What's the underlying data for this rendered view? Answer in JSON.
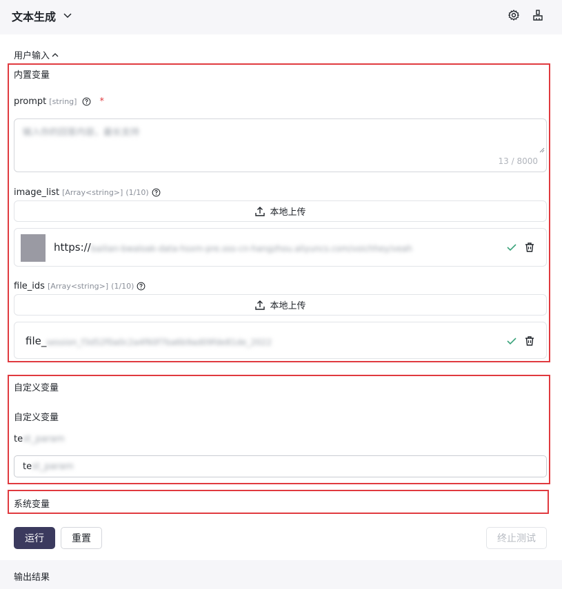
{
  "header": {
    "title": "文本生成",
    "settings_icon": "gear-icon",
    "clear_icon": "broom-icon"
  },
  "user_input": {
    "toggle_label": "用户输入"
  },
  "builtin": {
    "section_label": "内置变量",
    "prompt": {
      "name": "prompt",
      "type": "[string]",
      "required_mark": "*",
      "value": "输入你的回答内容，最长支持",
      "counter": "13 / 8000"
    },
    "image_list": {
      "name": "image_list",
      "type": "[Array<string>]",
      "count": "(1/10)",
      "upload_label": "本地上传",
      "file_prefix": "https://",
      "file_rest": "bailian-bwaloak-data-hsxm-pre.oss-cn-hangzhou.aliyuncs.com/voichhey/veah"
    },
    "file_ids": {
      "name": "file_ids",
      "type": "[Array<string>]",
      "count": "(1/10)",
      "upload_label": "本地上传",
      "file_prefix": "file_",
      "file_rest": "session_f3d52f0a0c2a4f60f7ba6b9ad09fde81de_2022"
    }
  },
  "custom": {
    "section_label": "自定义变量",
    "subtitle": "自定义变量",
    "var_prefix": "te",
    "var_rest": "st_param",
    "input_prefix": "te",
    "input_rest": "st_param"
  },
  "system": {
    "section_label": "系统变量"
  },
  "actions": {
    "run": "运行",
    "reset": "重置",
    "stop": "终止测试"
  },
  "output": {
    "label": "输出结果"
  },
  "colors": {
    "highlight_border": "#e0393e",
    "primary_button": "#3b3a5e",
    "success_check": "#3aa37b"
  }
}
